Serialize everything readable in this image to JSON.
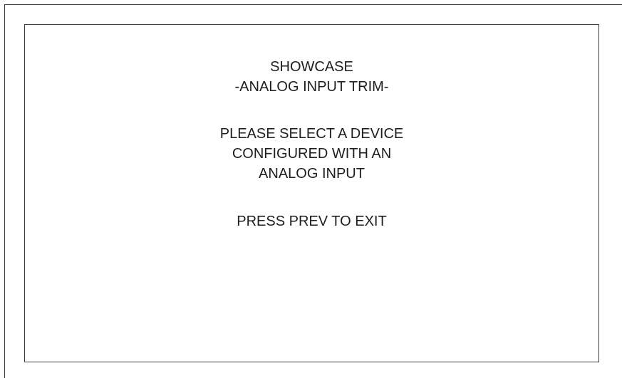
{
  "display": {
    "title": "SHOWCASE",
    "subtitle": "-ANALOG INPUT TRIM-",
    "message_lines": [
      "PLEASE SELECT A DEVICE",
      "CONFIGURED WITH AN",
      "ANALOG INPUT"
    ],
    "exit_prompt": "PRESS PREV TO EXIT"
  }
}
